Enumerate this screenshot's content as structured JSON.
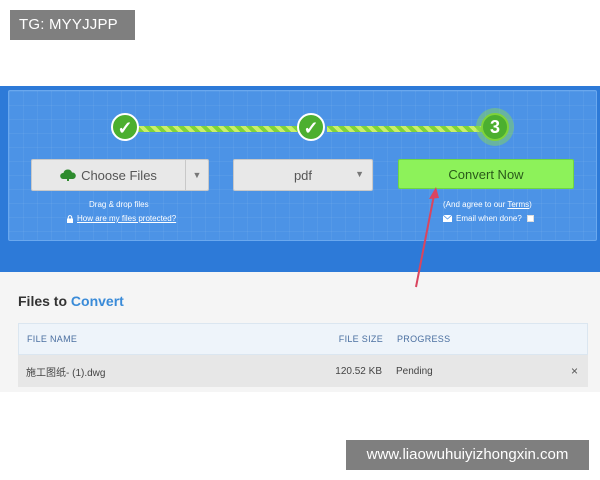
{
  "watermarks": {
    "top": "TG: MYYJJPP",
    "bottom": "www.liaowuhuiyizhongxin.com"
  },
  "steps": [
    {
      "symbol": "✓",
      "state": "done"
    },
    {
      "symbol": "✓",
      "state": "done"
    },
    {
      "symbol": "3",
      "state": "current"
    }
  ],
  "toolbar": {
    "choose_label": "Choose Files",
    "format_value": "pdf",
    "convert_label": "Convert Now"
  },
  "hints": {
    "drag_drop": "Drag & drop files",
    "protected_link": "How are my files protected?",
    "agree_prefix": "(And agree to our ",
    "terms_link": "Terms",
    "agree_suffix": ")",
    "email_label": "Email when done?"
  },
  "files": {
    "title_prefix": "Files to ",
    "title_accent": "Convert",
    "columns": {
      "name": "FILE NAME",
      "size": "FILE SIZE",
      "progress": "PROGRESS"
    },
    "rows": [
      {
        "name": "施工图纸- (1).dwg",
        "size": "120.52 KB",
        "progress": "Pending",
        "remove": "×"
      }
    ]
  },
  "colors": {
    "hero": "#2d7ad8",
    "convert": "#8df25a",
    "step": "#4caf2f",
    "accent": "#3a8bd8",
    "arrow": "#d9455f"
  }
}
